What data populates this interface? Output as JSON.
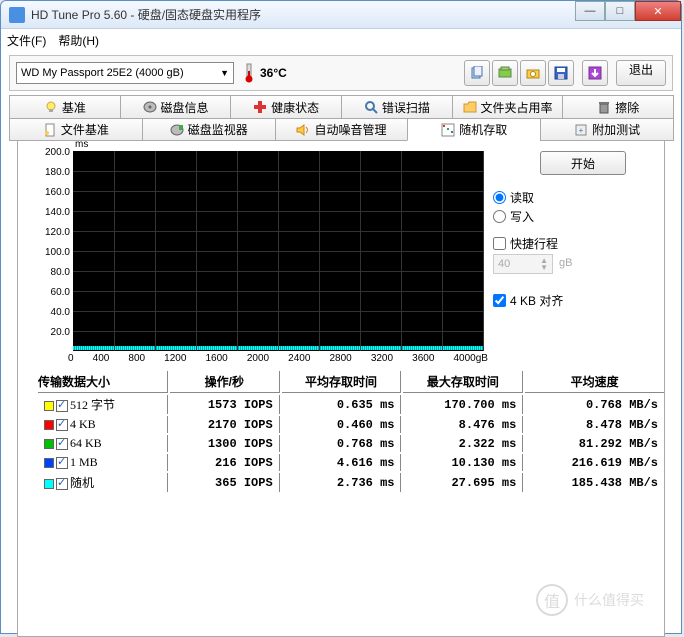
{
  "window": {
    "title": "HD Tune Pro 5.60 - 硬盘/固态硬盘实用程序"
  },
  "menu": {
    "file": "文件(F)",
    "help": "帮助(H)"
  },
  "toolbar": {
    "drive": "WD   My Passport 25E2 (4000 gB)",
    "temp": "36°C",
    "exit": "退出"
  },
  "tabs_top": [
    {
      "label": "基准",
      "icon": "bulb"
    },
    {
      "label": "磁盘信息",
      "icon": "disk"
    },
    {
      "label": "健康状态",
      "icon": "plus"
    },
    {
      "label": "错误扫描",
      "icon": "search"
    },
    {
      "label": "文件夹占用率",
      "icon": "folder"
    },
    {
      "label": "擦除",
      "icon": "trash"
    }
  ],
  "tabs_bottom": [
    {
      "label": "文件基准",
      "icon": "filebench"
    },
    {
      "label": "磁盘监视器",
      "icon": "monitor"
    },
    {
      "label": "自动噪音管理",
      "icon": "sound"
    },
    {
      "label": "随机存取",
      "icon": "random",
      "active": true
    },
    {
      "label": "附加测试",
      "icon": "extra"
    }
  ],
  "side": {
    "start": "开始",
    "read": "读取",
    "write": "写入",
    "short": "快捷行程",
    "short_val": "40",
    "gb": "gB",
    "align": "4 KB 对齐"
  },
  "graph": {
    "unit": "ms",
    "y_ticks": [
      "200.0",
      "180.0",
      "160.0",
      "140.0",
      "120.0",
      "100.0",
      "80.0",
      "60.0",
      "40.0",
      "20.0"
    ],
    "x_ticks": [
      "0",
      "400",
      "800",
      "1200",
      "1600",
      "2000",
      "2400",
      "2800",
      "3200",
      "3600",
      "4000gB"
    ]
  },
  "table": {
    "headers": [
      "传输数据大小",
      "操作/秒",
      "平均存取时间",
      "最大存取时间",
      "平均速度"
    ],
    "rows": [
      {
        "color": "#ffff00",
        "size": "512 字节",
        "iops": "1573 IOPS",
        "avg": "0.635 ms",
        "max": "170.700 ms",
        "speed": "0.768 MB/s"
      },
      {
        "color": "#ff0000",
        "size": "4 KB",
        "iops": "2170 IOPS",
        "avg": "0.460 ms",
        "max": "8.476 ms",
        "speed": "8.478 MB/s"
      },
      {
        "color": "#00c000",
        "size": "64 KB",
        "iops": "1300 IOPS",
        "avg": "0.768 ms",
        "max": "2.322 ms",
        "speed": "81.292 MB/s"
      },
      {
        "color": "#0040ff",
        "size": "1 MB",
        "iops": "216 IOPS",
        "avg": "4.616 ms",
        "max": "10.130 ms",
        "speed": "216.619 MB/s"
      },
      {
        "color": "#00ffff",
        "size": "随机",
        "iops": "365 IOPS",
        "avg": "2.736 ms",
        "max": "27.695 ms",
        "speed": "185.438 MB/s"
      }
    ]
  },
  "chart_data": {
    "type": "scatter",
    "title": "随机存取",
    "xlabel": "gB",
    "ylabel": "ms",
    "xlim": [
      0,
      4000
    ],
    "ylim": [
      0,
      200
    ],
    "note": "dense low-latency band near 0–2 ms across full 0–4000 gB range",
    "series": [
      {
        "name": "512 字节",
        "color": "#ffff00",
        "avg_ms": 0.635,
        "max_ms": 170.7,
        "iops": 1573,
        "mbps": 0.768
      },
      {
        "name": "4 KB",
        "color": "#ff0000",
        "avg_ms": 0.46,
        "max_ms": 8.476,
        "iops": 2170,
        "mbps": 8.478
      },
      {
        "name": "64 KB",
        "color": "#00c000",
        "avg_ms": 0.768,
        "max_ms": 2.322,
        "iops": 1300,
        "mbps": 81.292
      },
      {
        "name": "1 MB",
        "color": "#0040ff",
        "avg_ms": 4.616,
        "max_ms": 10.13,
        "iops": 216,
        "mbps": 216.619
      },
      {
        "name": "随机",
        "color": "#00ffff",
        "avg_ms": 2.736,
        "max_ms": 27.695,
        "iops": 365,
        "mbps": 185.438
      }
    ]
  },
  "watermark": "什么值得买"
}
